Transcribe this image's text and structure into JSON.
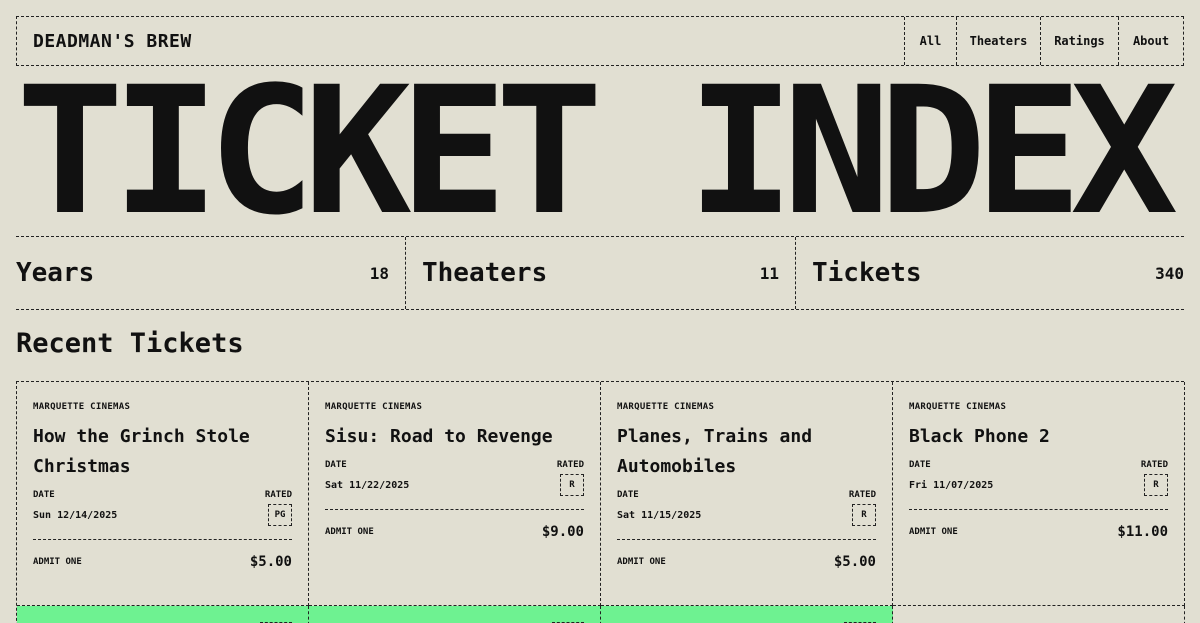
{
  "header": {
    "brand": "DEADMAN'S BREW",
    "nav": [
      "All",
      "Theaters",
      "Ratings",
      "About"
    ]
  },
  "hero": {
    "title": "TICKET INDEX"
  },
  "stats": [
    {
      "label": "Years",
      "value": "18"
    },
    {
      "label": "Theaters",
      "value": "11"
    },
    {
      "label": "Tickets",
      "value": "340"
    }
  ],
  "section": {
    "title": "Recent Tickets"
  },
  "labels": {
    "date": "DATE",
    "rated": "RATED",
    "admit": "ADMIT ONE"
  },
  "tickets": [
    {
      "venue": "MARQUETTE CINEMAS",
      "title": "How the Grinch Stole Christmas",
      "date": "Sun 12/14/2025",
      "rating": "PG",
      "price": "$5.00"
    },
    {
      "venue": "MARQUETTE CINEMAS",
      "title": "Sisu: Road to Revenge",
      "date": "Sat 11/22/2025",
      "rating": "R",
      "price": "$9.00"
    },
    {
      "venue": "MARQUETTE CINEMAS",
      "title": "Planes, Trains and Automobiles",
      "date": "Sat 11/15/2025",
      "rating": "R",
      "price": "$5.00"
    },
    {
      "venue": "MARQUETTE CINEMAS",
      "title": "Black Phone 2",
      "date": "Fri 11/07/2025",
      "rating": "R",
      "price": "$11.00"
    }
  ],
  "colors": {
    "background": "#e1dfd2",
    "ink": "#111111",
    "highlight": "#6ef291"
  }
}
